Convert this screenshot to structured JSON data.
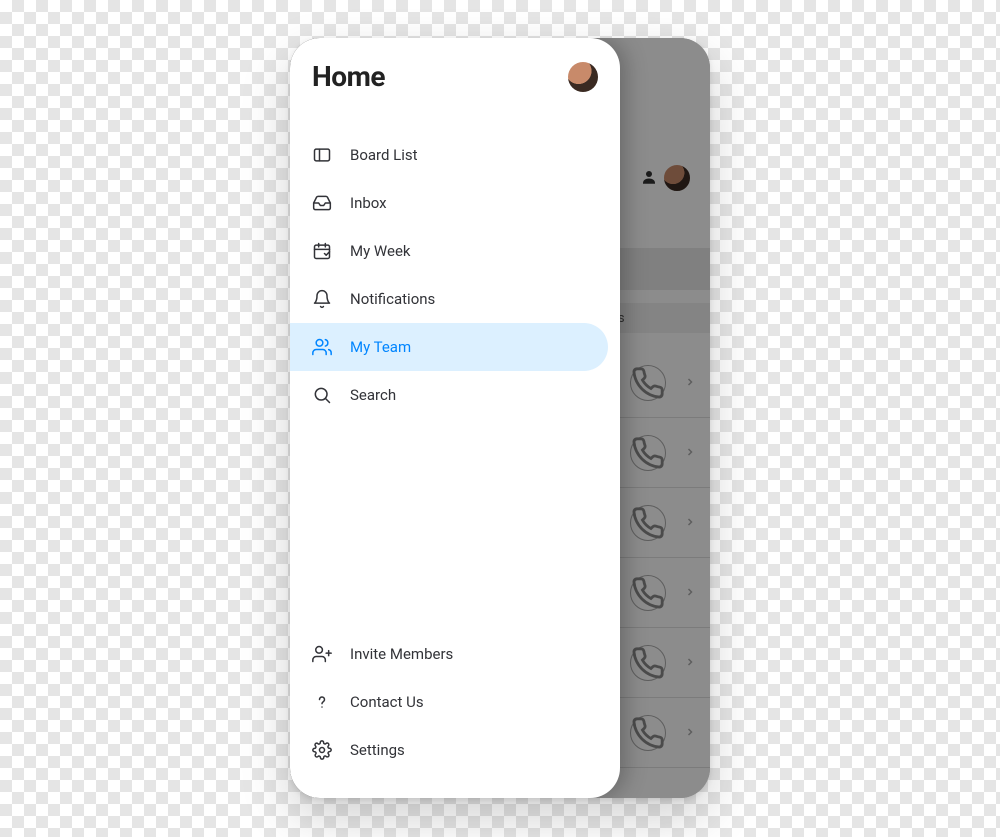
{
  "header": {
    "title": "Home"
  },
  "nav": {
    "items": [
      {
        "label": "Board List",
        "icon": "board-list-icon",
        "active": false
      },
      {
        "label": "Inbox",
        "icon": "inbox-icon",
        "active": false
      },
      {
        "label": "My Week",
        "icon": "calendar-icon",
        "active": false
      },
      {
        "label": "Notifications",
        "icon": "bell-icon",
        "active": false
      },
      {
        "label": "My Team",
        "icon": "team-icon",
        "active": true
      },
      {
        "label": "Search",
        "icon": "search-icon",
        "active": false
      }
    ]
  },
  "footer": {
    "items": [
      {
        "label": "Invite Members",
        "icon": "invite-icon"
      },
      {
        "label": "Contact Us",
        "icon": "question-icon"
      },
      {
        "label": "Settings",
        "icon": "gear-icon"
      }
    ]
  },
  "background": {
    "segment_visible_label": "ests",
    "list_row_count": 6
  },
  "colors": {
    "accent": "#0085ff",
    "active_bg": "#dcf0ff",
    "text": "#323338"
  }
}
